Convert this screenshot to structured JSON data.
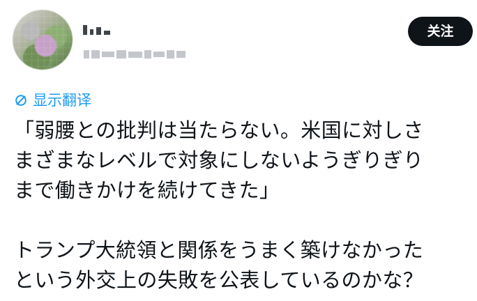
{
  "header": {
    "follow_label": "关注"
  },
  "translate": {
    "label": "显示翻译",
    "icon": "translate-icon",
    "color": "#1d9bf0"
  },
  "tweet": {
    "paragraph1": {
      "line1": "「弱腰との批判は当たらない。米国に対しさ",
      "line2": "まざまなレベルで対象にしないようぎりぎり",
      "line3": "まで働きかけを続けてきた」"
    },
    "paragraph2": {
      "line1": "トランプ大統領と関係をうまく築けなかった",
      "line2": "という外交上の失敗を公表しているのかな？"
    }
  },
  "colors": {
    "text": "#0f1419",
    "button_bg": "#0f1419",
    "button_text": "#ffffff",
    "link": "#1d9bf0"
  }
}
